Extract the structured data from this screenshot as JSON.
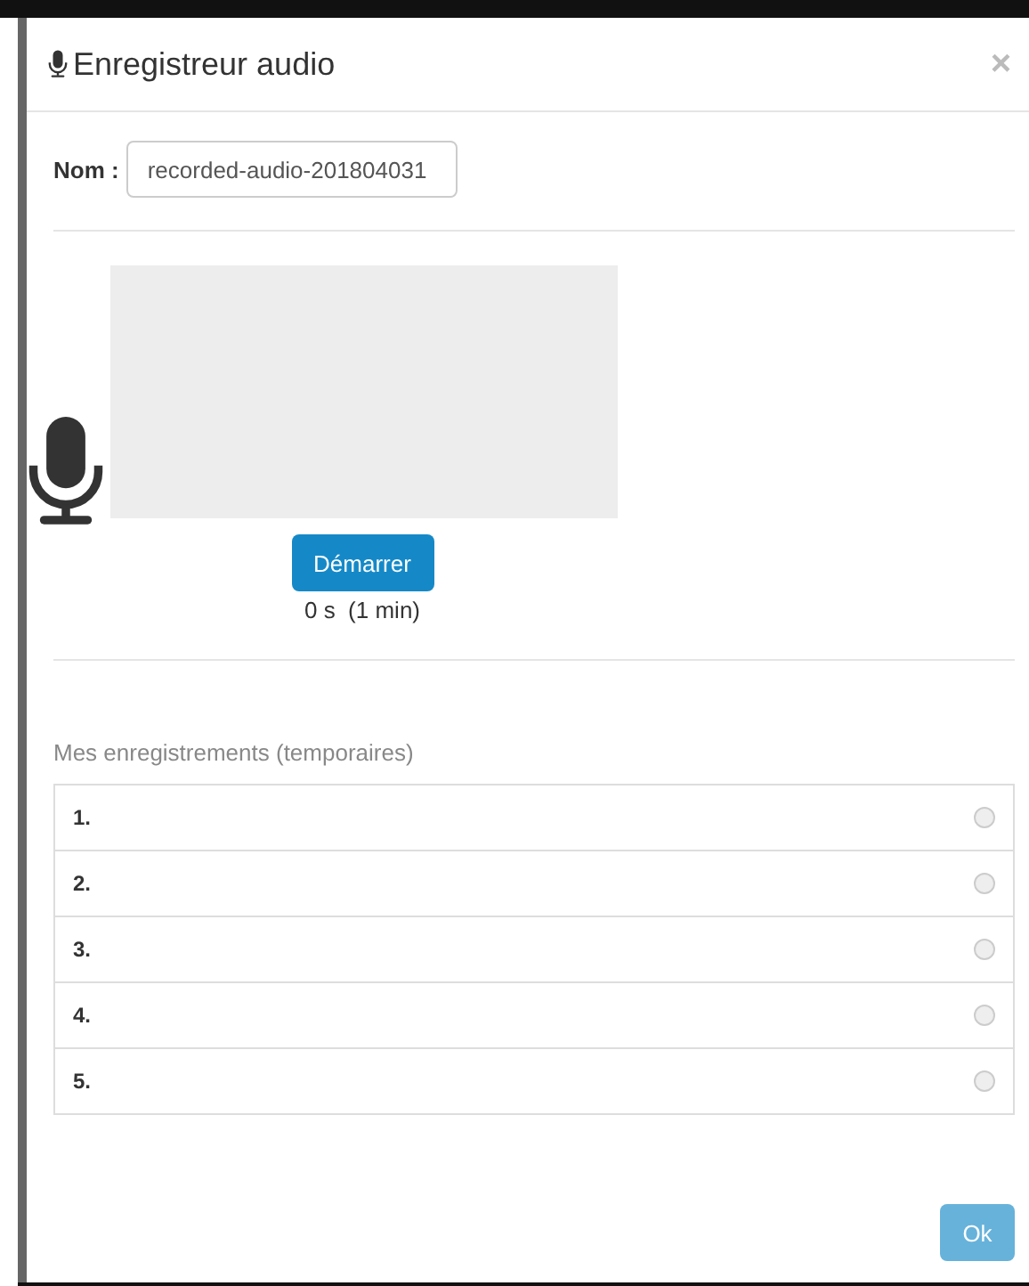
{
  "dialog": {
    "title": "Enregistreur audio",
    "close": "×"
  },
  "name_field": {
    "label": "Nom :",
    "value": "recorded-audio-201804031"
  },
  "recorder": {
    "start_button": "Démarrer",
    "timer": "0 s  (1 min)"
  },
  "recordings": {
    "heading": "Mes enregistrements (temporaires)",
    "items": [
      {
        "label": "1.",
        "selected": false
      },
      {
        "label": "2.",
        "selected": false
      },
      {
        "label": "3.",
        "selected": false
      },
      {
        "label": "4.",
        "selected": false
      },
      {
        "label": "5.",
        "selected": false
      }
    ]
  },
  "ok_button": {
    "label": "Ok",
    "disabled": true
  }
}
